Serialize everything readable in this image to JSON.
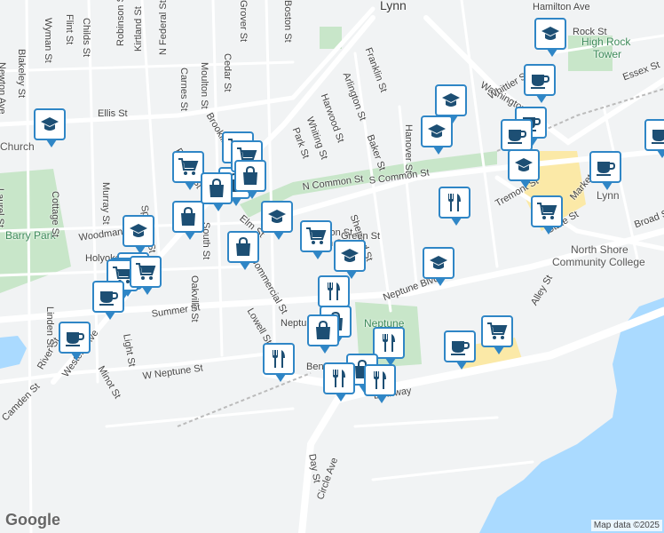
{
  "map": {
    "attribution_logo": "Google",
    "credit": "Map data ©2025",
    "colors": {
      "land": "#f1f3f4",
      "water": "#aadaff",
      "park": "#c8e6c9",
      "road": "#ffffff",
      "highlight": "#fbe9a7",
      "pin_border": "#2f86c6",
      "pin_icon": "#1d4f74"
    },
    "place_labels": [
      {
        "text": "Lynn",
        "style": "big"
      },
      {
        "text": "High Rock",
        "style": "poi"
      },
      {
        "text": "Tower",
        "style": "poi"
      },
      {
        "text": "Barry Park",
        "style": "poi"
      },
      {
        "text": "North Shore",
        "style": "poi2"
      },
      {
        "text": "Community College",
        "style": "poi2"
      },
      {
        "text": "Neptune",
        "style": "poi"
      },
      {
        "text": "Lynn",
        "style": "poi2"
      },
      {
        "text": "Church",
        "style": "poi2"
      }
    ],
    "street_labels": [
      "Newton Ave",
      "Blakeley St",
      "Wyman St",
      "Flint St",
      "Childs St",
      "Robinson St",
      "Kirtland St",
      "N Federal St",
      "Carnes St",
      "Moulton St",
      "Cedar St",
      "Grover St",
      "Boston St",
      "Franklin St",
      "Arlington St",
      "Harwood St",
      "Whiting St",
      "Park St",
      "Baker St",
      "Hanover St",
      "Washington St",
      "Whittier St",
      "Rock St",
      "Hamilton Ave",
      "Essex St",
      "N Common St",
      "S Common St",
      "Shepard St",
      "Tremont St",
      "Market St",
      "State St",
      "Broad St",
      "Elm St",
      "South St",
      "Oakville St",
      "Lowell St",
      "Neptune Blvd",
      "Neptune St",
      "Summer St",
      "Light St",
      "Minot St",
      "Western Ave",
      "River St",
      "Camden St",
      "Linden St",
      "Cottage St",
      "Murray St",
      "Spencer St",
      "Woodman St",
      "Laurel St",
      "Holyoke St",
      "Alley St",
      "Bennett St",
      "Lynnway",
      "Day St",
      "Circle Ave",
      "W Neptune St",
      "Union St",
      "Commercial St",
      "Elton St",
      "Brookline St",
      "Ellis St",
      "Fayette St",
      "Green St"
    ],
    "markers": [
      {
        "type": "school"
      },
      {
        "type": "cafe"
      },
      {
        "type": "school"
      },
      {
        "type": "cafe"
      },
      {
        "type": "cafe"
      },
      {
        "type": "school"
      },
      {
        "type": "school"
      },
      {
        "type": "cafe"
      },
      {
        "type": "cafe"
      },
      {
        "type": "grocery"
      },
      {
        "type": "restaurant"
      },
      {
        "type": "school"
      },
      {
        "type": "school"
      },
      {
        "type": "grocery"
      },
      {
        "type": "school"
      },
      {
        "type": "grocery"
      },
      {
        "type": "shopping"
      },
      {
        "type": "grocery"
      },
      {
        "type": "shopping"
      },
      {
        "type": "grocery"
      },
      {
        "type": "shopping"
      },
      {
        "type": "shopping"
      },
      {
        "type": "school"
      },
      {
        "type": "grocery"
      },
      {
        "type": "shopping"
      },
      {
        "type": "school"
      },
      {
        "type": "grocery"
      },
      {
        "type": "grocery"
      },
      {
        "type": "school"
      },
      {
        "type": "restaurant"
      },
      {
        "type": "shopping"
      },
      {
        "type": "shopping"
      },
      {
        "type": "cafe"
      },
      {
        "type": "cafe"
      },
      {
        "type": "restaurant"
      },
      {
        "type": "restaurant"
      },
      {
        "type": "shopping"
      },
      {
        "type": "restaurant"
      },
      {
        "type": "restaurant"
      },
      {
        "type": "cafe"
      },
      {
        "type": "grocery"
      }
    ]
  }
}
